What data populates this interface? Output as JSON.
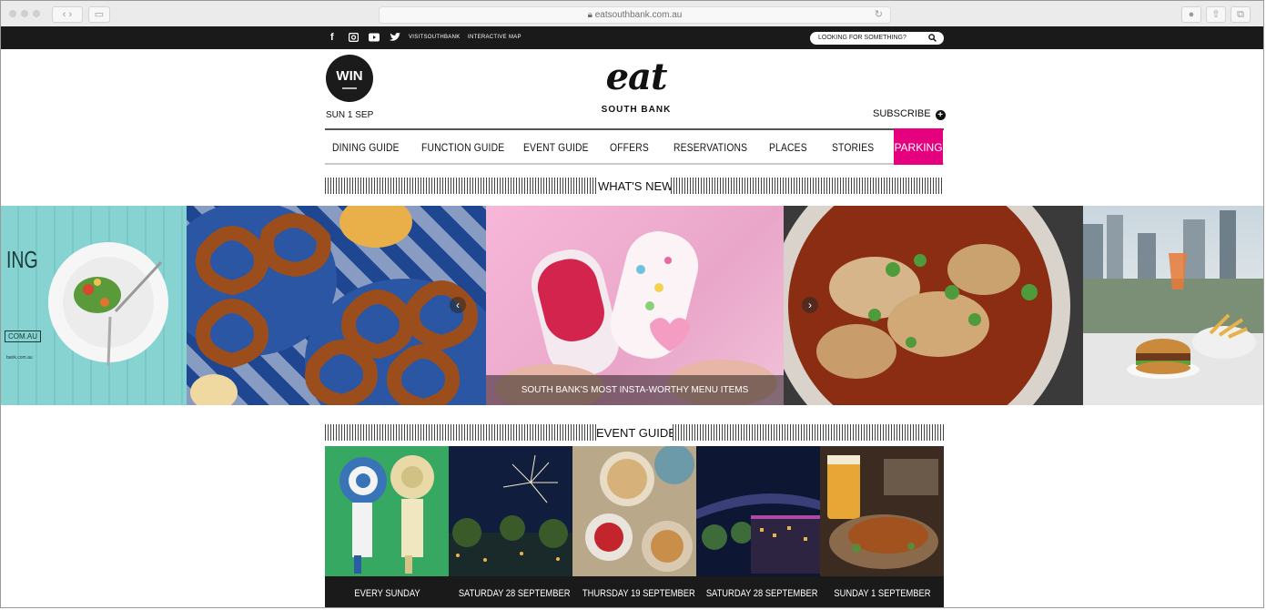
{
  "browser": {
    "url": "eatsouthbank.com.au",
    "lock_icon": "lock-icon",
    "reload_icon": "reload-icon"
  },
  "topbar": {
    "social_icons": [
      "facebook-icon",
      "instagram-icon",
      "youtube-icon",
      "twitter-icon"
    ],
    "links": [
      "VISITSOUTHBANK",
      "INTERACTIVE MAP"
    ],
    "search_placeholder": "LOOKING FOR SOMETHING?"
  },
  "header": {
    "win_badge": "WIN",
    "date": "SUN 1 SEP",
    "logo_main": "eat",
    "logo_sub": "SOUTH BANK",
    "subscribe": "SUBSCRIBE"
  },
  "nav": {
    "items": [
      "DINING GUIDE",
      "FUNCTION GUIDE",
      "EVENT GUIDE",
      "OFFERS",
      "RESERVATIONS",
      "PLACES",
      "STORIES",
      "PARKING"
    ],
    "highlight_color": "#e5007e"
  },
  "whats_new": {
    "heading": "WHAT'S NEW",
    "slide1_text": "ING",
    "slide1_button": "COM.AU",
    "slide1_small": "bank.com.au",
    "caption": "SOUTH BANK'S MOST INSTA-WORTHY MENU ITEMS"
  },
  "event_guide": {
    "heading": "EVENT GUIDE",
    "events": [
      "EVERY SUNDAY",
      "SATURDAY 28 SEPTEMBER",
      "THURSDAY 19 SEPTEMBER",
      "SATURDAY 28 SEPTEMBER",
      "SUNDAY 1 SEPTEMBER"
    ]
  }
}
